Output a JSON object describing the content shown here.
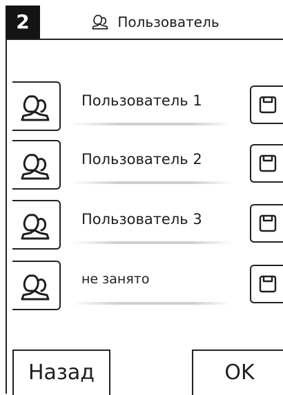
{
  "header": {
    "page_number": "2",
    "title": "Пользователь"
  },
  "users": [
    {
      "label": "Пользователь 1"
    },
    {
      "label": "Пользователь 2"
    },
    {
      "label": "Пользователь 3"
    },
    {
      "label": "не занято"
    }
  ],
  "footer": {
    "back_label": "Назад",
    "ok_label": "OK"
  },
  "icons": {
    "title_icon": "user-icon",
    "row_icon": "user-icon",
    "save_icon": "floppy-disk-icon"
  }
}
